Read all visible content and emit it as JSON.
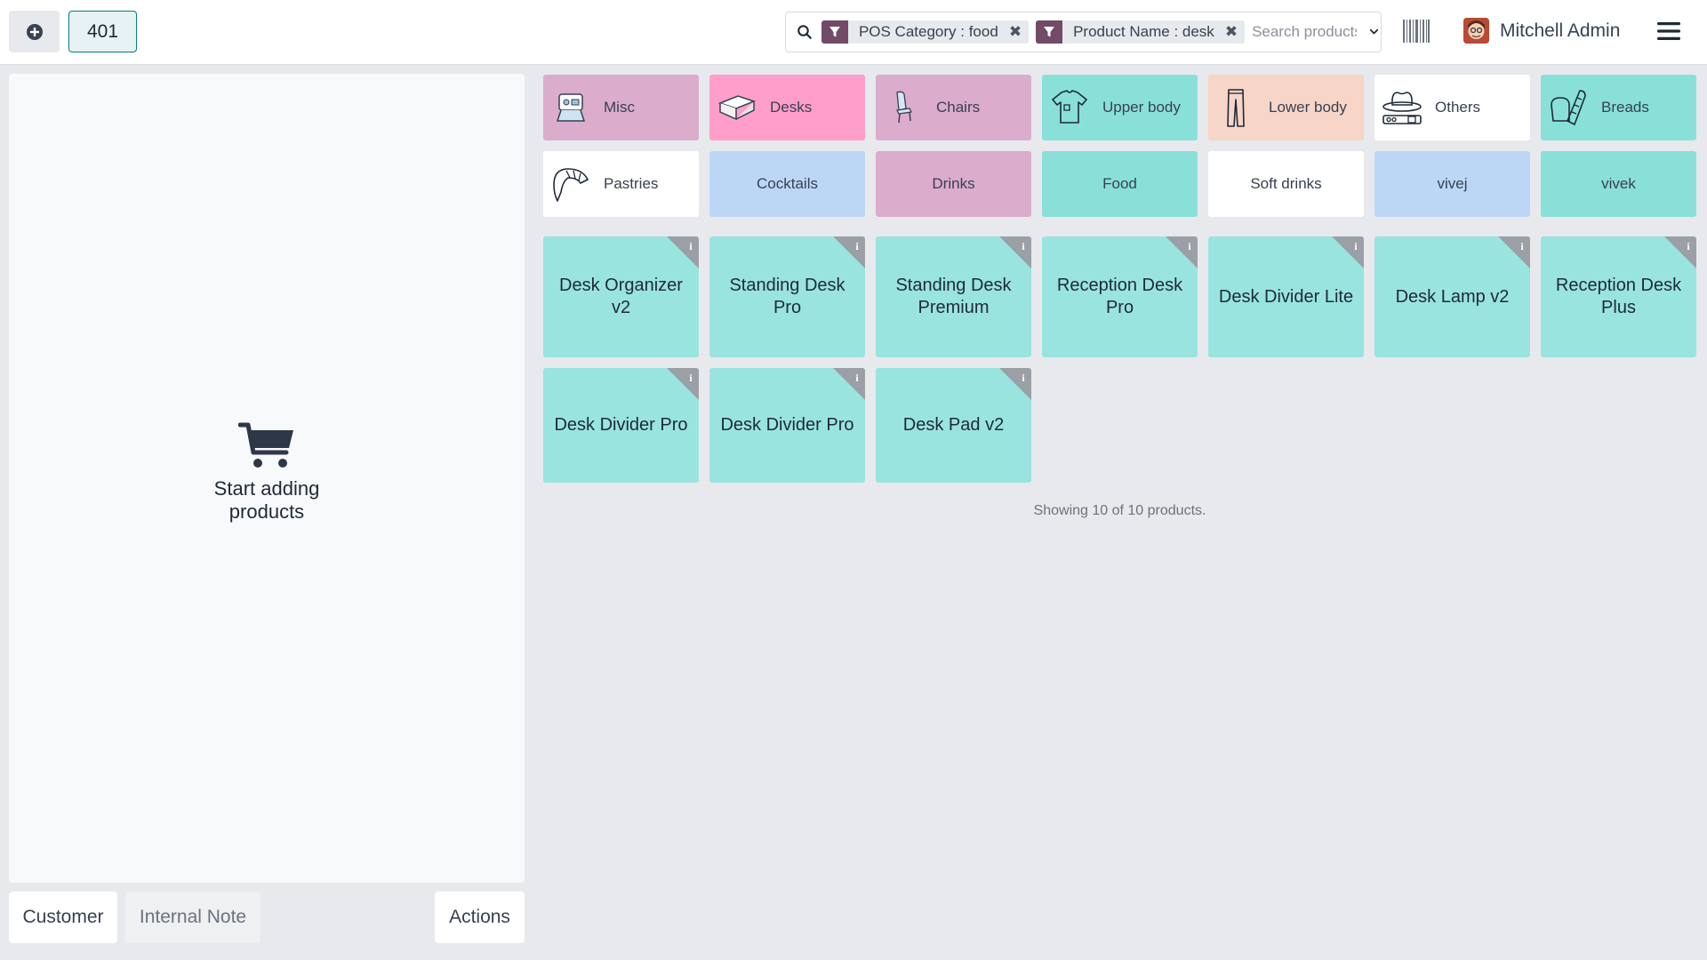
{
  "header": {
    "order_number": "401",
    "search": {
      "facets": [
        {
          "label": "POS Category : food"
        },
        {
          "label": "Product Name : desk"
        }
      ],
      "placeholder": "Search products..."
    },
    "user_name": "Mitchell Admin"
  },
  "order": {
    "empty_line1": "Start adding",
    "empty_line2": "products"
  },
  "actions": {
    "customer": "Customer",
    "internal_note": "Internal Note",
    "actions": "Actions"
  },
  "categories": [
    {
      "label": "Misc",
      "icon": "misc-icon",
      "color": "#dcaccc"
    },
    {
      "label": "Desks",
      "icon": "desk-icon",
      "color": "#ff9ecb"
    },
    {
      "label": "Chairs",
      "icon": "chair-icon",
      "color": "#dcaccc"
    },
    {
      "label": "Upper body",
      "icon": "tshirt-icon",
      "color": "#89e0d9"
    },
    {
      "label": "Lower body",
      "icon": "trousers-icon",
      "color": "#f7d5c7"
    },
    {
      "label": "Others",
      "icon": "hat-icon",
      "color": "#ffffff"
    },
    {
      "label": "Breads",
      "icon": "bread-icon",
      "color": "#89e0d9"
    },
    {
      "label": "Pastries",
      "icon": "croissant-icon",
      "color": "#ffffff"
    },
    {
      "label": "Cocktails",
      "icon": "",
      "color": "#bcd7f5"
    },
    {
      "label": "Drinks",
      "icon": "",
      "color": "#dcaccc"
    },
    {
      "label": "Food",
      "icon": "",
      "color": "#89e0d9"
    },
    {
      "label": "Soft drinks",
      "icon": "",
      "color": "#ffffff"
    },
    {
      "label": "vivej",
      "icon": "",
      "color": "#bcd7f5"
    },
    {
      "label": "vivek",
      "icon": "",
      "color": "#89e0d9"
    }
  ],
  "products": [
    {
      "name": "Desk Organizer v2"
    },
    {
      "name": "Standing Desk Pro"
    },
    {
      "name": "Standing Desk Premium"
    },
    {
      "name": "Reception Desk Pro"
    },
    {
      "name": "Desk Divider Lite"
    },
    {
      "name": "Desk Lamp v2"
    },
    {
      "name": "Reception Desk Plus"
    },
    {
      "name": "Desk Divider Pro"
    },
    {
      "name": "Desk Divider Pro"
    },
    {
      "name": "Desk Pad v2"
    }
  ],
  "products_status": "Showing 10 of 10 products."
}
